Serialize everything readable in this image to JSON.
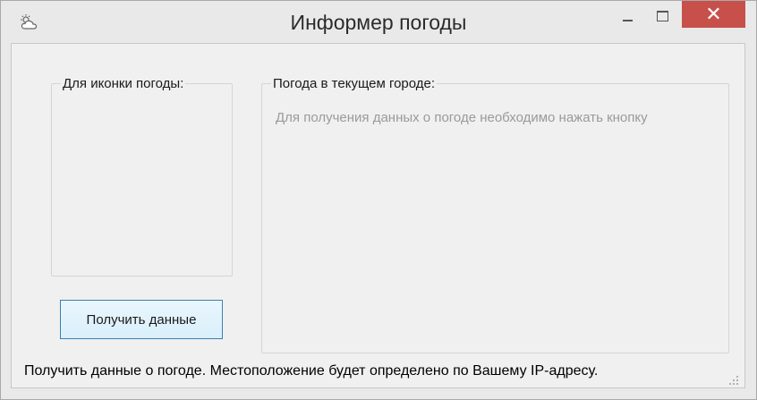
{
  "window": {
    "title": "Информер погоды",
    "icon": "cloud-sun-icon",
    "controls": {
      "minimize": "minimize-icon",
      "maximize": "maximize-icon",
      "close": "✕"
    },
    "colors": {
      "close_bg": "#c7504b",
      "button_border": "#3c7fb1",
      "hint_text": "#9a9a9a"
    }
  },
  "icon_group": {
    "label": "Для иконки погоды:"
  },
  "weather_group": {
    "label": "Погода в текущем городе:",
    "info": "Для получения данных о погоде необходимо нажать кнопку"
  },
  "get_button": {
    "label": "Получить данные"
  },
  "status": {
    "text": "Получить данные о погоде. Местоположение будет определено по Вашему IP-адресу."
  }
}
